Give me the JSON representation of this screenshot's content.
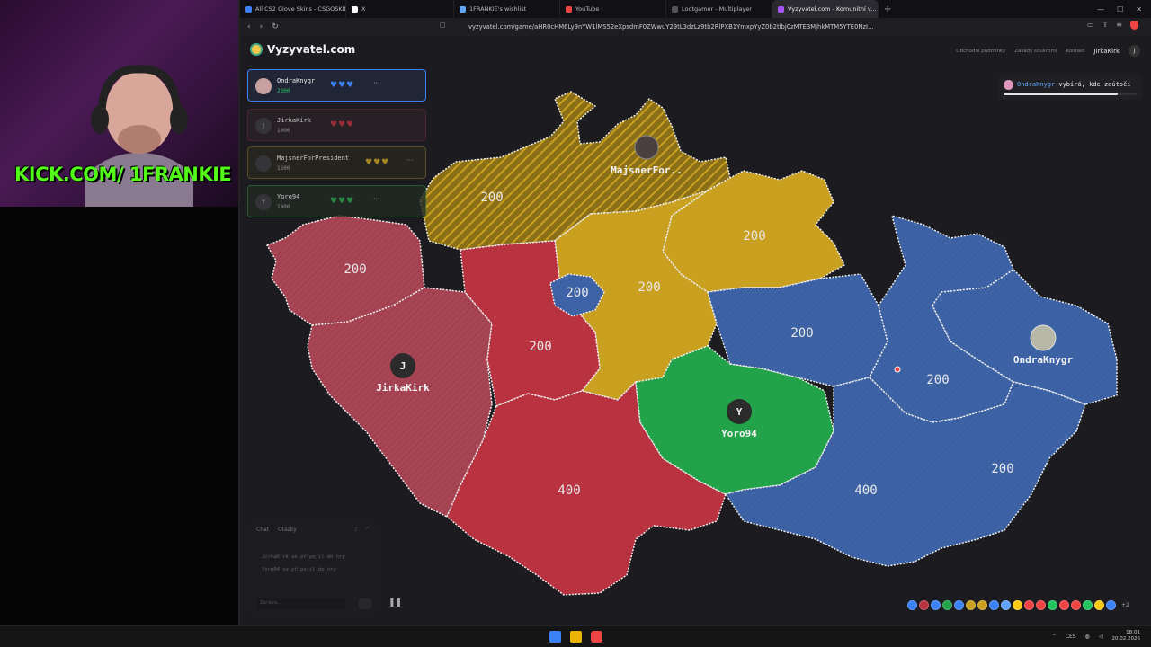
{
  "stream": {
    "caption": "KICK.COM/ 1FRANKIE"
  },
  "browser": {
    "tabs": [
      {
        "title": "All CS2 Glove Skins - CSGOSKINS.GG",
        "color": "#3b82f6",
        "active": false
      },
      {
        "title": "X",
        "color": "#ffffff",
        "active": false
      },
      {
        "title": "1FRANKIE's wishlist",
        "color": "#60a5fa",
        "active": false
      },
      {
        "title": "YouTube",
        "color": "#ef4444",
        "active": false
      },
      {
        "title": "Lootgamer - Multiplayer",
        "color": "#555555",
        "active": false
      },
      {
        "title": "Vyzyvatel.com - Komunitní v...",
        "color": "#a855f7",
        "active": true
      }
    ],
    "url": "vyzyvatel.com/game/aHR0cHM6Ly9nYW1lMS52eXpsdmF0ZWwuY29tL3dzLz9tb2RlPXB1YmxpYyZ0b2tlbj0zMTE3MjhkMTM5YTE0NzI..."
  },
  "site": {
    "logo": "Vyzyvatel.com",
    "nav": [
      "Obchodní podmínky",
      "Zásady soukromí",
      "Kontakt"
    ],
    "username": "JirkaKirk",
    "user_initial": "J"
  },
  "players": [
    {
      "name": "OndraKnygr",
      "score": "2300",
      "hearts": "♥♥♥",
      "initial": "",
      "more": "···"
    },
    {
      "name": "JirkaKirk",
      "score": "1900",
      "hearts": "♥♥♥",
      "initial": "J",
      "more": ""
    },
    {
      "name": "MajsnerForPresident",
      "score": "1600",
      "hearts": "♥♥♥",
      "initial": "",
      "more": "···"
    },
    {
      "name": "Yoro94",
      "score": "1000",
      "hearts": "♥♥♥",
      "initial": "Y",
      "more": "···"
    }
  ],
  "status": {
    "player": "OndraKnygr",
    "text": " vybírá, kde zaútočí",
    "progress": 0.86
  },
  "map": {
    "colors": {
      "red": "#b8323f",
      "gold": "#c9a020",
      "blue": "#3d63a6",
      "green": "#22a34a",
      "pink": "#a84555"
    },
    "region_values": [
      "200",
      "200",
      "200",
      "200",
      "200",
      "200",
      "200",
      "200",
      "200",
      "200",
      "200",
      "400",
      "400",
      "200"
    ],
    "player_markers": [
      {
        "name": "MajsnerFor..",
        "initial": ""
      },
      {
        "name": "JirkaKirk",
        "initial": "J"
      },
      {
        "name": "Yoro94",
        "initial": "Y"
      },
      {
        "name": "OndraKnygr",
        "initial": ""
      }
    ]
  },
  "chat": {
    "tab_chat": "Chat",
    "tab_questions": "Otázky",
    "messages": [
      "JirkaKirk se připojil do hry",
      "Yoro94 se připojil do hry"
    ],
    "placeholder": "Zpráva..."
  },
  "palette": [
    "#3b82f6",
    "#b83240",
    "#3b82f6",
    "#22a34a",
    "#3b82f6",
    "#c9a020",
    "#c9a020",
    "#3b82f6",
    "#60a5fa",
    "#facc15",
    "#ef4444",
    "#ef4444",
    "#22c55e",
    "#ef4444",
    "#ef4444",
    "#22c55e",
    "#facc15",
    "#3b82f6"
  ],
  "palette_more": "+2",
  "taskbar": {
    "lang": "CES",
    "time": "18:01",
    "date": "20.02.2026"
  }
}
